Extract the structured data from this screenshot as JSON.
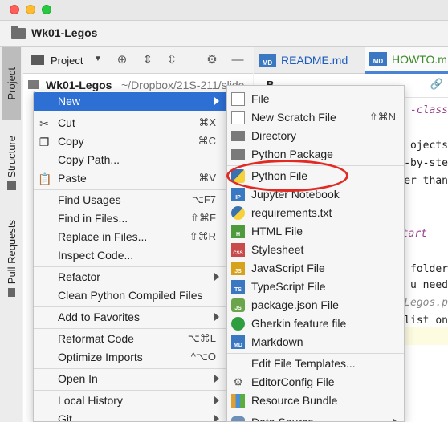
{
  "window": {
    "title": "Wk01-Legos"
  },
  "left_strip": {
    "project": "Project",
    "structure": "Structure",
    "pull_requests": "Pull Requests"
  },
  "project_panel": {
    "label": "Project",
    "root_name": "Wk01-Legos",
    "root_path": "~/Dropbox/21S-211/slide"
  },
  "tabs": [
    {
      "label": "README.md",
      "icon": "MD"
    },
    {
      "label": "HOWTO.m",
      "icon": "MD"
    }
  ],
  "editor_lines": [
    "-class",
    "ojects",
    "-by-ste",
    "er than",
    "start",
    "folder",
    "u need",
    "Legos.p",
    "list on"
  ],
  "context_menu": {
    "items": [
      {
        "label": "New",
        "shortcut": "",
        "submenu": true
      },
      {
        "label": "Cut",
        "shortcut": "⌘X",
        "icon": "scissors-icon"
      },
      {
        "label": "Copy",
        "shortcut": "⌘C",
        "icon": "copy-icon"
      },
      {
        "label": "Copy Path...",
        "shortcut": ""
      },
      {
        "label": "Paste",
        "shortcut": "⌘V",
        "icon": "paste-icon"
      },
      {
        "label": "Find Usages",
        "shortcut": "⌥F7"
      },
      {
        "label": "Find in Files...",
        "shortcut": "⇧⌘F"
      },
      {
        "label": "Replace in Files...",
        "shortcut": "⇧⌘R"
      },
      {
        "label": "Inspect Code...",
        "shortcut": ""
      },
      {
        "label": "Refactor",
        "shortcut": "",
        "submenu": true
      },
      {
        "label": "Clean Python Compiled Files",
        "shortcut": ""
      },
      {
        "label": "Add to Favorites",
        "shortcut": "",
        "submenu": true
      },
      {
        "label": "Reformat Code",
        "shortcut": "⌥⌘L"
      },
      {
        "label": "Optimize Imports",
        "shortcut": "^⌥O"
      },
      {
        "label": "Open In",
        "shortcut": "",
        "submenu": true
      },
      {
        "label": "Local History",
        "shortcut": "",
        "submenu": true
      },
      {
        "label": "Git",
        "shortcut": "",
        "submenu": true
      }
    ]
  },
  "submenu": {
    "items": [
      {
        "label": "File",
        "shortcut": "",
        "icon": "file-icon"
      },
      {
        "label": "New Scratch File",
        "shortcut": "⇧⌘N",
        "icon": "scratch-file-icon"
      },
      {
        "label": "Directory",
        "shortcut": "",
        "icon": "folder-icon"
      },
      {
        "label": "Python Package",
        "shortcut": "",
        "icon": "python-package-icon"
      },
      {
        "label": "Python File",
        "shortcut": "",
        "icon": "python-file-icon"
      },
      {
        "label": "Jupyter Notebook",
        "shortcut": "",
        "icon": "jupyter-icon",
        "badge": "IP"
      },
      {
        "label": "requirements.txt",
        "shortcut": "",
        "icon": "python-requirements-icon"
      },
      {
        "label": "HTML File",
        "shortcut": "",
        "icon": "html-icon",
        "badge": "H"
      },
      {
        "label": "Stylesheet",
        "shortcut": "",
        "icon": "css-icon",
        "badge": "CSS"
      },
      {
        "label": "JavaScript File",
        "shortcut": "",
        "icon": "javascript-icon",
        "badge": "JS"
      },
      {
        "label": "TypeScript File",
        "shortcut": "",
        "icon": "typescript-icon",
        "badge": "TS"
      },
      {
        "label": "package.json File",
        "shortcut": "",
        "icon": "nodejs-icon",
        "badge": "JS"
      },
      {
        "label": "Gherkin feature file",
        "shortcut": "",
        "icon": "gherkin-icon"
      },
      {
        "label": "Markdown",
        "shortcut": "",
        "icon": "markdown-icon",
        "badge": "MD"
      },
      {
        "label": "Edit File Templates...",
        "shortcut": ""
      },
      {
        "label": "EditorConfig File",
        "shortcut": "",
        "icon": "editorconfig-icon"
      },
      {
        "label": "Resource Bundle",
        "shortcut": "",
        "icon": "resource-bundle-icon"
      },
      {
        "label": "Data Source",
        "shortcut": "",
        "icon": "database-icon",
        "submenu": true
      }
    ]
  },
  "colors": {
    "menu_highlight": "#2d6fd3",
    "annotation": "#e32a22",
    "tab_active_text": "#3a8a2a",
    "tab_text": "#1b5bbd"
  }
}
